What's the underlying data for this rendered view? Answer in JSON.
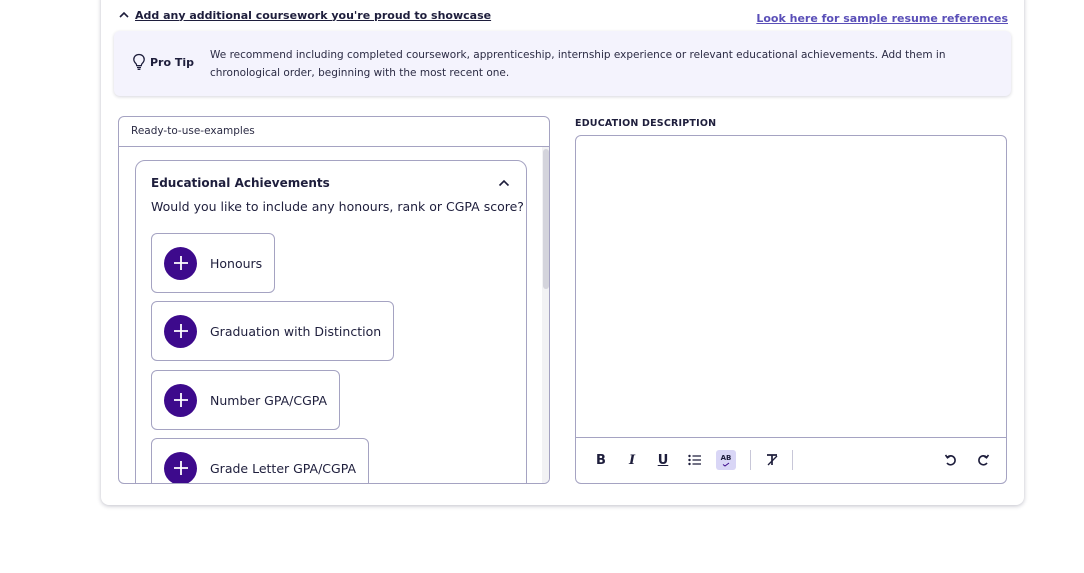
{
  "header": {
    "additional_link": "Add any additional coursework you're proud to showcase",
    "sample_link": "Look here for sample resume references"
  },
  "protip": {
    "title": "Pro Tip",
    "text": "We recommend including completed coursework, apprenticeship, internship experience or relevant educational achievements. Add them in chronological order, beginning with the most recent one."
  },
  "examples": {
    "header": "Ready-to-use-examples",
    "section": {
      "title": "Educational Achievements",
      "question": "Would you like to include any honours, rank or CGPA score?",
      "items": [
        {
          "label": "Honours"
        },
        {
          "label": "Graduation with Distinction"
        },
        {
          "label": "Number GPA/CGPA"
        },
        {
          "label": "Grade Letter GPA/CGPA"
        }
      ]
    }
  },
  "editor": {
    "label": "EDUCATION DESCRIPTION",
    "content": "",
    "toolbar": {
      "bold": "B",
      "italic": "I",
      "underline": "U",
      "spellcheck": "AB"
    },
    "spellcheck_active_color": "#d9d6f6"
  },
  "colors": {
    "accent": "#3d0a8c",
    "link": "#5a4fb8",
    "protip_bg": "#f4f3fd",
    "border": "#a5a3c2"
  }
}
